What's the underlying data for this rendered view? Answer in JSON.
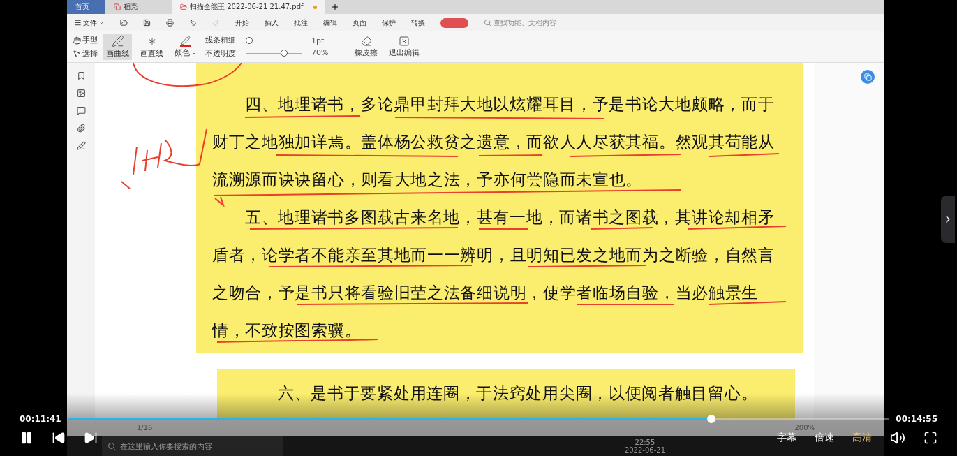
{
  "tabs": [
    {
      "label": "首页",
      "kind": "home",
      "selected": false
    },
    {
      "label": "稻壳",
      "kind": "app",
      "selected": false
    },
    {
      "label": "扫描全能王 2022-06-21 21.47.pdf",
      "kind": "doc",
      "selected": true
    }
  ],
  "menu": {
    "file": "文件",
    "items": [
      {
        "label": "开始",
        "selected": false
      },
      {
        "label": "插入",
        "selected": false
      },
      {
        "label": "批注",
        "selected": false
      },
      {
        "label": "编辑",
        "selected": false
      },
      {
        "label": "页面",
        "selected": false
      },
      {
        "label": "保护",
        "selected": false
      },
      {
        "label": "转换",
        "selected": false
      }
    ],
    "search": {
      "placeholder": "查找功能、文档内容"
    }
  },
  "toolbar": {
    "hand": "手型",
    "select": "选择",
    "tools": [
      {
        "label": "画曲线",
        "kind": "curve",
        "selected": true
      },
      {
        "label": "画直线",
        "kind": "line",
        "selected": false
      }
    ],
    "color_label": "颜色",
    "thickness": {
      "label": "线条粗细",
      "level": 0,
      "value": "1pt"
    },
    "opacity": {
      "label": "不透明度",
      "level": 0.72,
      "value": "70%"
    },
    "eraser": "橡皮擦",
    "exit": "退出编辑"
  },
  "document": {
    "blocks": [
      {
        "paragraphs": [
          {
            "lines": [
              "四、地理诸书，多论鼎甲封拜大地以炫耀耳目，予是书论大地颇略，而于",
              "财丁之地独加详焉。盖体杨公救贫之遗意，而欲人人尽获其福。然观其苟能从",
              "流溯源而诀诀留心，则看大地之法，予亦何尝隐而未宣也。"
            ]
          },
          {
            "lines": [
              "五、地理诸书多图载古来名地，甚有一地，而诸书之图载，其讲论却相矛",
              "盾者，论学者不能亲至其地而一一辨明，且明知已发之地而为之断验，自然言",
              "之吻合，予是书只将看验旧茔之法备细说明，使学者临场自验，当必触景生",
              "情，不致按图索骥。"
            ]
          }
        ]
      },
      {
        "paragraphs": [
          {
            "lines": [
              "六、是书于要紧处用连圈，于法窍处用尖圈，以便阅者触目留心。"
            ]
          }
        ]
      }
    ]
  },
  "status_bar": {
    "page": "1/16",
    "zoom": "200%"
  },
  "taskbar": {
    "search": {
      "placeholder": "在这里输入你要搜索的内容"
    },
    "time": "22:55",
    "date": "2022-06-21"
  },
  "player": {
    "current": "00:11:41",
    "total": "00:14:55",
    "progress": {
      "level": 0.784
    },
    "options": [
      {
        "label": "字幕",
        "selected": false
      },
      {
        "label": "倍速",
        "selected": false
      },
      {
        "label": "高清",
        "selected": true
      }
    ]
  }
}
